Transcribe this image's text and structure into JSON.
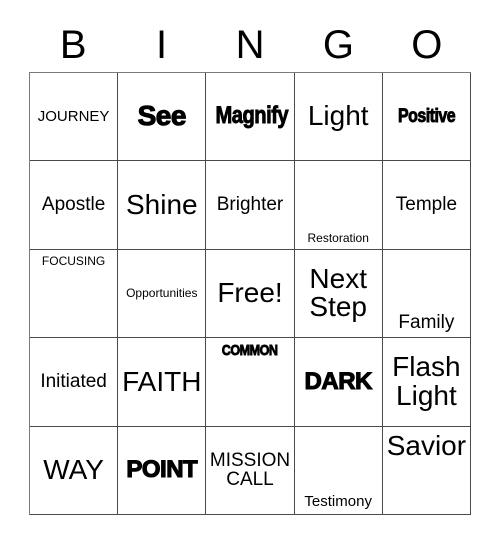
{
  "header": {
    "letters": [
      "B",
      "I",
      "N",
      "G",
      "O"
    ]
  },
  "grid": {
    "rows": 5,
    "columns": 5,
    "cells": [
      {
        "text": "JOURNEY",
        "size": "sm",
        "weight": "regular",
        "align": "center"
      },
      {
        "text": "See",
        "size": "xl",
        "weight": "heavy",
        "align": "center"
      },
      {
        "text": "Magnify",
        "size": "lg",
        "weight": "heavy-condensed",
        "align": "center"
      },
      {
        "text": "Light",
        "size": "xl",
        "weight": "regular",
        "align": "center"
      },
      {
        "text": "Positive",
        "size": "md",
        "weight": "heavy-condensed",
        "align": "center"
      },
      {
        "text": "Apostle",
        "size": "md",
        "weight": "regular",
        "align": "center"
      },
      {
        "text": "Shine",
        "size": "xl",
        "weight": "regular",
        "align": "center"
      },
      {
        "text": "Brighter",
        "size": "md",
        "weight": "regular",
        "align": "center"
      },
      {
        "text": "Restoration",
        "size": "xs",
        "weight": "regular",
        "align": "bottom"
      },
      {
        "text": "Temple",
        "size": "md",
        "weight": "regular",
        "align": "center"
      },
      {
        "text": "FOCUSING",
        "size": "xs",
        "weight": "regular",
        "align": "top"
      },
      {
        "text": "Opportunities",
        "size": "xs",
        "weight": "regular",
        "align": "center"
      },
      {
        "text": "Free!",
        "size": "xl",
        "weight": "regular",
        "align": "center"
      },
      {
        "text": "Next\nStep",
        "size": "xl",
        "weight": "regular",
        "align": "center"
      },
      {
        "text": "Family",
        "size": "md",
        "weight": "regular",
        "align": "bottom"
      },
      {
        "text": "Initiated",
        "size": "md",
        "weight": "regular",
        "align": "center"
      },
      {
        "text": "FAITH",
        "size": "xl",
        "weight": "regular",
        "align": "center"
      },
      {
        "text": "COMMON",
        "size": "sm",
        "weight": "heavy-condensed",
        "align": "top"
      },
      {
        "text": "DARK",
        "size": "lg",
        "weight": "heavy",
        "align": "center"
      },
      {
        "text": "Flash\nLight",
        "size": "xl",
        "weight": "regular",
        "align": "center"
      },
      {
        "text": "WAY",
        "size": "xl",
        "weight": "regular",
        "align": "center"
      },
      {
        "text": "POINT",
        "size": "lg",
        "weight": "heavy",
        "align": "center"
      },
      {
        "text": "MISSION\nCALL",
        "size": "md",
        "weight": "regular",
        "align": "center"
      },
      {
        "text": "Testimony",
        "size": "sm",
        "weight": "regular",
        "align": "bottom"
      },
      {
        "text": "Savior",
        "size": "xl",
        "weight": "regular",
        "align": "top"
      }
    ]
  },
  "colors": {
    "background": "#ffffff",
    "text": "#000000",
    "grid_line": "#4a4a4a"
  }
}
